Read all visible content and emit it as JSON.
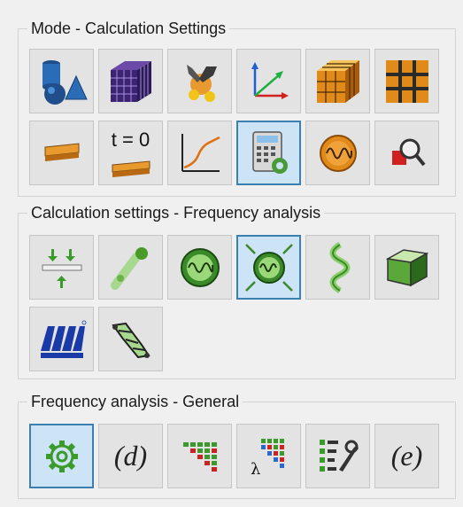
{
  "groups": {
    "mode": {
      "title": "Mode - Calculation Settings"
    },
    "calc": {
      "title": "Calculation settings - Frequency analysis"
    },
    "freq": {
      "title": "Frequency analysis - General"
    }
  },
  "labels": {
    "t_zero": "t = 0",
    "d_formula": "(d)",
    "e_formula": "(e)",
    "lambda": "λ"
  },
  "active_buttons": [
    "calculation-settings",
    "frequency-analysis",
    "general-settings"
  ],
  "icons": {
    "row1": [
      "geometry-shapes-icon",
      "mesh-cube-icon",
      "wrench-nodes-icon",
      "coordinate-axes-icon",
      "grid-cube-icon",
      "frame-grid-icon"
    ],
    "row2": [
      "beam-element-icon",
      "initial-state-beam-icon",
      "result-curve-icon",
      "calculator-gear-icon",
      "frequency-wave-icon",
      "zoom-node-icon"
    ],
    "row3": [
      "supports-load-icon",
      "beam-nodes-icon",
      "frequency-circle-icon",
      "frequency-arrows-icon",
      "spring-shape-icon",
      "green-cube-icon"
    ],
    "row4": [
      "logo-icon",
      "truss-structure-icon"
    ],
    "row5": [
      "gear-icon",
      "matrix-d-icon",
      "mass-matrix-icon",
      "lambda-matrix-icon",
      "list-wrench-icon",
      "matrix-e-icon"
    ]
  }
}
